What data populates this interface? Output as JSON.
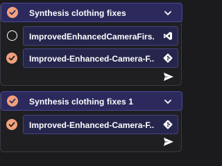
{
  "groups": [
    {
      "title": "Synthesis clothing fixes",
      "header_icon": "check-circle-icon",
      "expand_icon": "chevron-down-icon",
      "items": [
        {
          "label": "ImprovedEnhancedCameraFirs...",
          "status_icon": "empty-circle-icon",
          "type_icon": "visual-studio-icon"
        },
        {
          "label": "Improved-Enhanced-Camera-F...",
          "status_icon": "check-circle-icon",
          "type_icon": "git-icon"
        }
      ],
      "action_icon": "send-icon"
    },
    {
      "title": "Synthesis clothing fixes 1",
      "header_icon": "check-circle-icon",
      "expand_icon": "chevron-down-icon",
      "items": [
        {
          "label": "Improved-Enhanced-Camera-F...",
          "status_icon": "check-circle-icon",
          "type_icon": "git-icon"
        }
      ],
      "action_icon": "send-icon"
    }
  ],
  "colors": {
    "background": "#1b1b1d",
    "header_bg": "#2c2a5c",
    "row_bg": "#26264d",
    "accent_check": "#f2a07d",
    "text": "#ffffff"
  }
}
